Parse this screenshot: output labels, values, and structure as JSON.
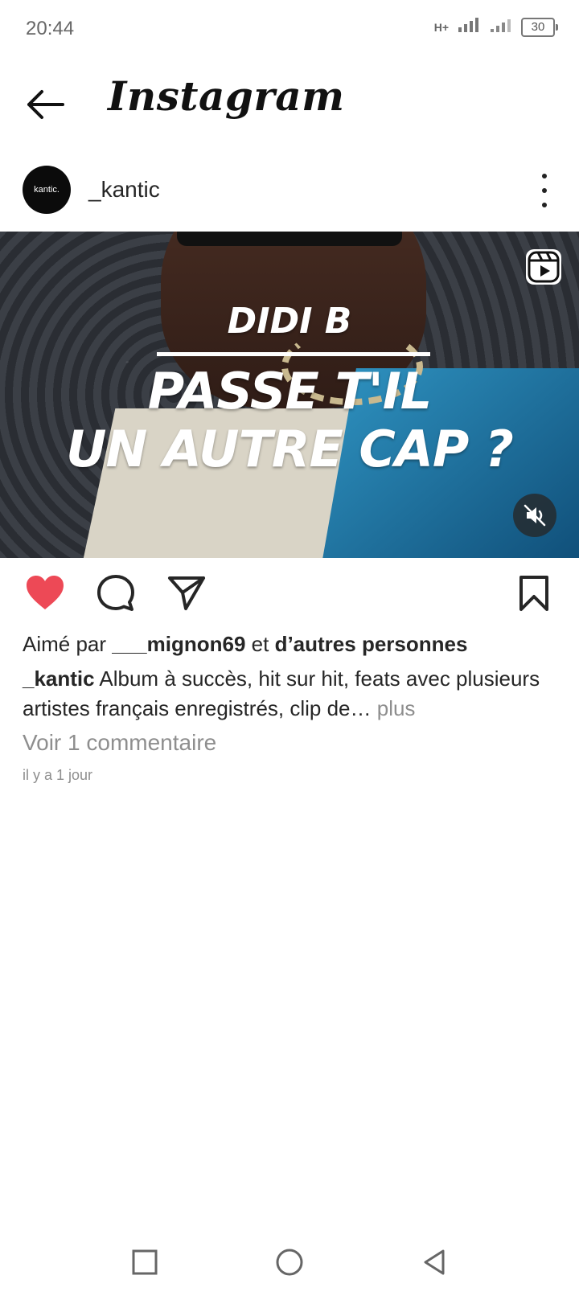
{
  "status_bar": {
    "time": "20:44",
    "network": "H+",
    "battery": "30"
  },
  "header": {
    "title": "Instagram",
    "back_icon": "back-arrow-icon"
  },
  "post": {
    "avatar_text": "kantic.",
    "username": "_kantic",
    "more_icon": "more-vertical-icon",
    "media": {
      "line1": "DIDI B",
      "line2": "PASSE T'IL",
      "line3": "UN AUTRE CAP ?",
      "reels_icon": "reels-icon",
      "mute_icon": "mute-icon"
    },
    "actions": {
      "like_icon": "heart-icon",
      "comment_icon": "comment-icon",
      "share_icon": "send-icon",
      "save_icon": "bookmark-icon",
      "liked": true,
      "like_color": "#ed4956"
    },
    "likes": {
      "prefix": "Aimé par ",
      "user": "___mignon69",
      "middle": " et ",
      "suffix": "d’autres personnes"
    },
    "caption": {
      "username": "_kantic",
      "text": " Album à succès, hit sur hit, feats avec plusieurs artistes français enregistrés, clip de…",
      "more": " plus"
    },
    "comments_link": "Voir 1 commentaire",
    "timestamp": "il y a 1 jour"
  },
  "nav": {
    "recent_icon": "square-recent-icon",
    "home_icon": "circle-home-icon",
    "back_icon": "triangle-back-icon"
  }
}
